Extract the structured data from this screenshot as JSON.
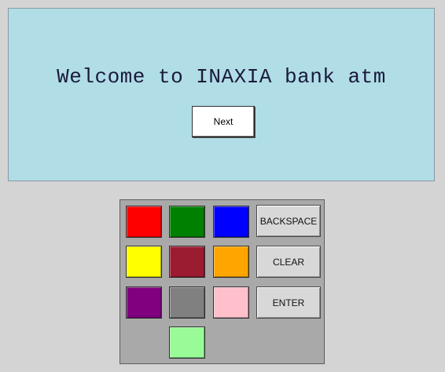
{
  "screen": {
    "welcome_text": "Welcome to INAXIA bank atm",
    "next_label": "Next"
  },
  "keypad": {
    "colors": {
      "red": "#ff0000",
      "green": "#008000",
      "blue": "#0000ff",
      "yellow": "#ffff00",
      "maroon": "#9b1b30",
      "orange": "#ffa500",
      "purple": "#800080",
      "gray": "#808080",
      "pink": "#ffc0cb",
      "light_green": "#98fb98"
    },
    "backspace_label": "BACKSPACE",
    "clear_label": "CLEAR",
    "enter_label": "ENTER"
  }
}
